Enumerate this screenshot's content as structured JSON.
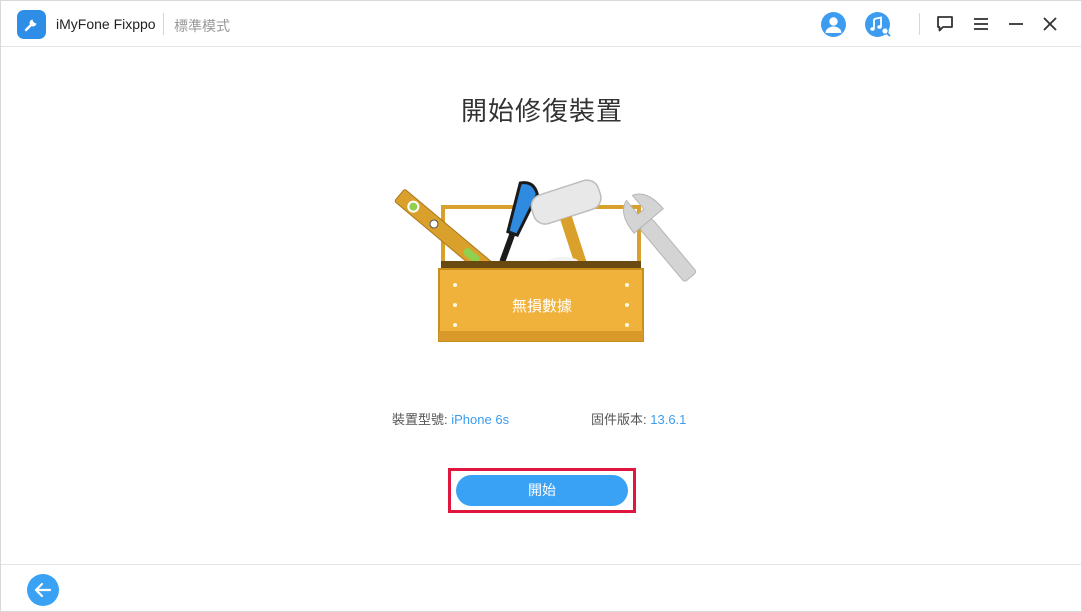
{
  "app": {
    "name": "iMyFone Fixppo",
    "mode": "標準模式"
  },
  "main": {
    "title": "開始修復裝置",
    "box_label": "無損數據",
    "device_model_label": "裝置型號:",
    "device_model_value": "iPhone 6s",
    "firmware_label": "固件版本:",
    "firmware_value": "13.6.1",
    "start_button": "開始"
  },
  "colors": {
    "accent": "#3aa2f5",
    "highlight": "#e0163e",
    "toolbox": "#f0b23a"
  },
  "icons": {
    "user": "user-icon",
    "music_search": "music-search-icon",
    "feedback": "feedback-icon",
    "menu": "menu-icon",
    "minimize": "minimize-icon",
    "close": "close-icon",
    "back": "back-arrow-icon"
  }
}
